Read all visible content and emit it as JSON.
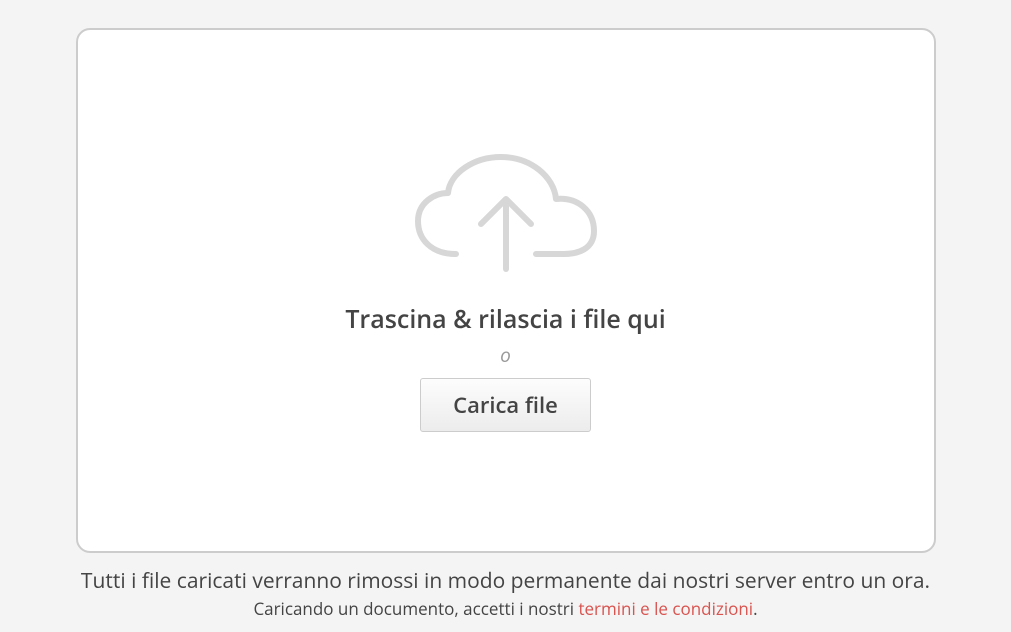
{
  "dropzone": {
    "drag_label": "Trascina & rilascia i file qui",
    "or_label": "o",
    "button_label": "Carica file"
  },
  "notice": {
    "line1": "Tutti i file caricati verranno rimossi in modo permanente dai nostri server entro un ora.",
    "line2_prefix": "Caricando un documento, accetti i nostri ",
    "terms_link": "termini e le condizioni",
    "line2_suffix": "."
  }
}
